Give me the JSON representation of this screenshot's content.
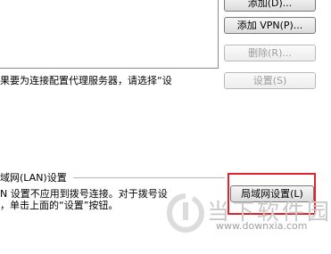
{
  "buttons": {
    "add_top": "添加(D)...",
    "add_vpn": "添加 VPN(P)...",
    "delete": "删除(R)...",
    "settings": "设置(S)",
    "lan_settings": "局域网设置(L)"
  },
  "proxy_text": "果要为连接配置代理服务器，请选择“设",
  "lan": {
    "group_title": "域网(LAN)设置",
    "desc_line1": "N 设置不应用到拨号连接。对于拨号设",
    "desc_line2": "，单击上面的“设置”按钮。"
  },
  "watermark": {
    "brand": "当下软件园",
    "url": "www.downxia.com"
  },
  "colors": {
    "highlight": "#e0232a"
  }
}
